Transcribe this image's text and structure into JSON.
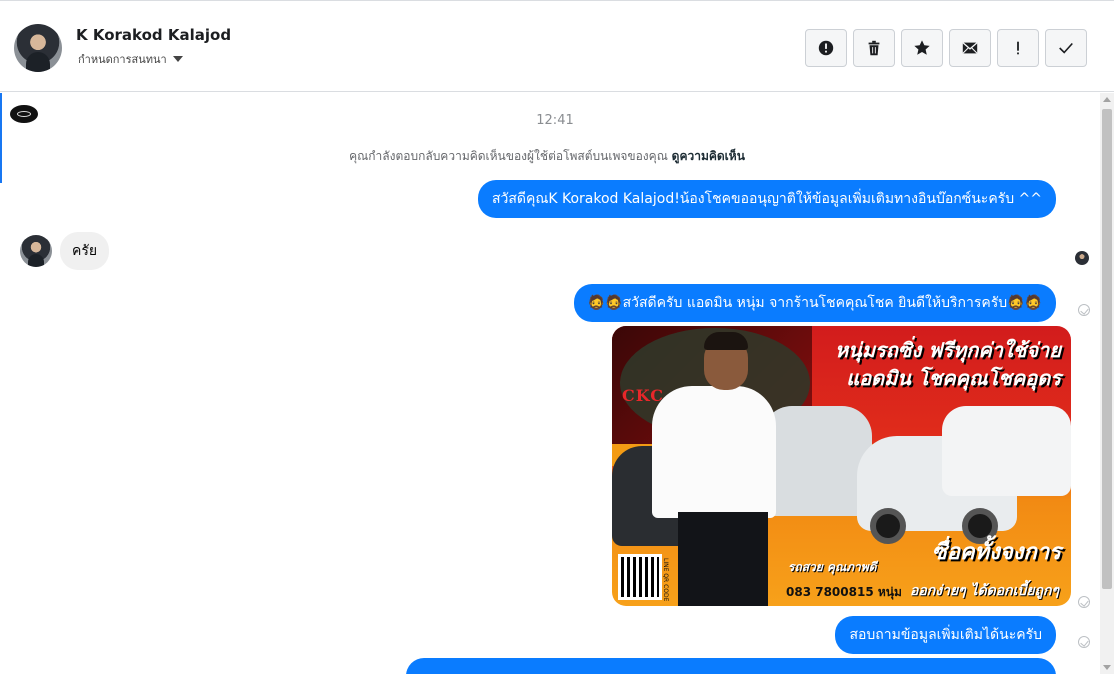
{
  "header": {
    "contact_name": "K Korakod Kalajod",
    "conversation_menu_label": "กำหนดการสนทนา",
    "actions": [
      {
        "name": "report-button",
        "icon": "alert-circle-icon"
      },
      {
        "name": "delete-button",
        "icon": "trash-icon"
      },
      {
        "name": "star-button",
        "icon": "star-icon"
      },
      {
        "name": "mark-unread-button",
        "icon": "envelope-icon"
      },
      {
        "name": "mark-important-button",
        "icon": "exclamation-icon"
      },
      {
        "name": "mark-done-button",
        "icon": "check-icon"
      }
    ]
  },
  "thread": {
    "timestamp": "12:41",
    "notice_text": "คุณกำลังตอบกลับความคิดเห็นของผู้ใช้ต่อโพสต์บนเพจของคุณ",
    "notice_link": "ดูความคิดเห็น",
    "messages": [
      {
        "direction": "outgoing",
        "text": "สวัสดีคุณK Korakod Kalajod!น้องโชคขออนุญาติให้ข้อมูลเพิ่มเติมทางอินบ๊อกซ์นะครับ ^^"
      },
      {
        "direction": "incoming",
        "text": "ครัย"
      },
      {
        "direction": "outgoing",
        "text": "🧔🧔สวัสดีครับ แอดมิน หนุ่ม จากร้านโชคคุณโชค ยินดีให้บริการครับ🧔🧔"
      },
      {
        "direction": "outgoing",
        "type": "image"
      },
      {
        "direction": "outgoing",
        "text": "สอบถามข้อมูลเพิ่มเติมได้นะครับ"
      }
    ],
    "promo_image": {
      "logo_text": "CKC",
      "headline_line1": "หนุ่มรถซิ่ง ฟรีทุกค่าใช้จ่าย",
      "headline_line2": "แอดมิน โชคคุณโชคอุดร",
      "tagline_small": "รถสวย คุณภาพดี",
      "tagline_large": "ซื่อคทั้งจงการ",
      "phone": "083 7800815",
      "phone_name": "หนุ่ม",
      "tagline_bottom": "ออกง่ายๆ ได้ดอกเบี้ยถูกๆ",
      "qr_label": "LINE QR CODE"
    }
  },
  "colors": {
    "outgoing_bubble": "#0a7cff",
    "incoming_bubble": "#f0f0f0",
    "accent": "#1877f2"
  }
}
